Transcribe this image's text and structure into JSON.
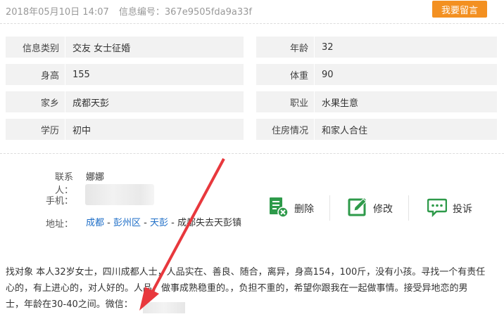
{
  "header": {
    "date": "2018年05月10日 14:07",
    "info_id": "信息编号：367e9505fda9a33f",
    "leave_message": "我要留言"
  },
  "details": {
    "category": {
      "label": "信息类别",
      "value": "交友 女士征婚"
    },
    "age": {
      "label": "年龄",
      "value": "32"
    },
    "height": {
      "label": "身高",
      "value": "155"
    },
    "weight": {
      "label": "体重",
      "value": "90"
    },
    "hometown": {
      "label": "家乡",
      "value": "成都天彭"
    },
    "occupation": {
      "label": "职业",
      "value": "水果生意"
    },
    "education": {
      "label": "学历",
      "value": "初中"
    },
    "housing": {
      "label": "住房情况",
      "value": "和家人合住"
    }
  },
  "contact": {
    "person_label": "联系人：",
    "person": "娜娜",
    "phone_label": "手机：",
    "address_label": "地址：",
    "address": {
      "city": "成都",
      "district": "彭州区",
      "town": "天彭",
      "detail": "成都失去天彭镇",
      "separator": " - "
    }
  },
  "actions": {
    "delete": "删除",
    "edit": "修改",
    "report": "投诉"
  },
  "description": {
    "line1": "找对象 本人32岁女士，四川成都人士，人品实在、善良、随合，离异，身高154，100斤，没有小孩。寻找一个有责任",
    "line2": "心的，有上进心的，对人好的。人品，做事成熟稳重的。，负担不重的，希望你跟我在一起做事情。接受异地恋的男",
    "line3": "士，年龄在30-40之间。微信："
  },
  "colors": {
    "accent": "#f39021",
    "link": "#1e6ec7",
    "icon_green": "#2e9a4a",
    "arrow_red": "#e8383d"
  }
}
